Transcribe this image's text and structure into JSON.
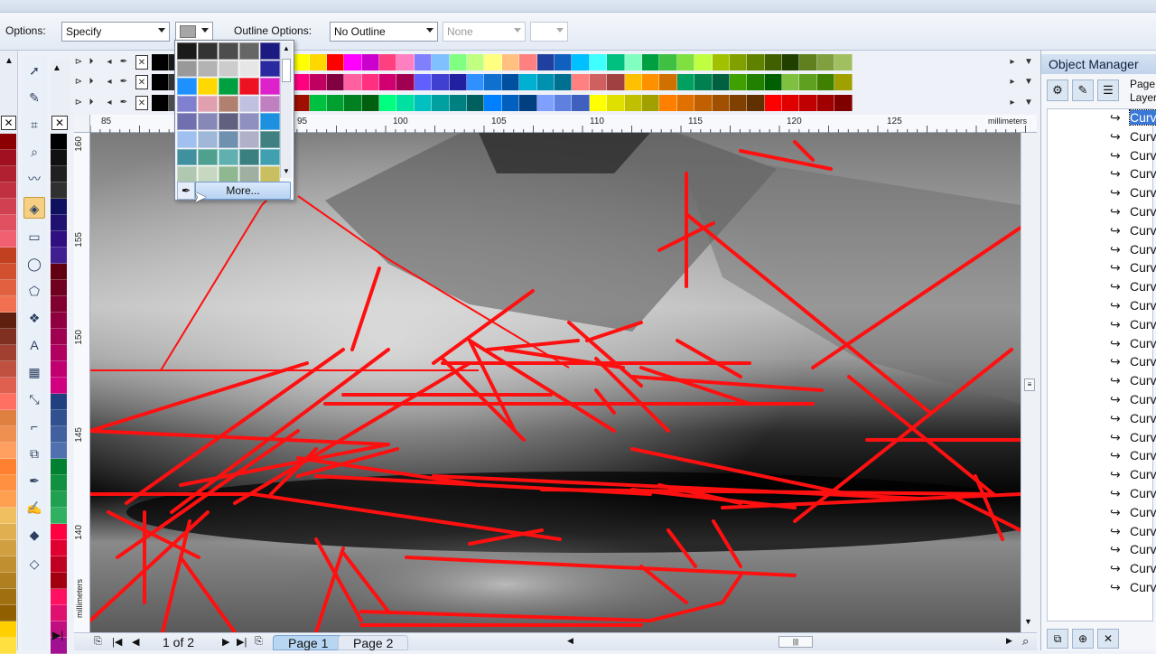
{
  "propbar": {
    "options_label": "Options:",
    "fill_select": "Specify",
    "outline_label": "Outline Options:",
    "outline_select": "No Outline",
    "width_select": "None"
  },
  "ruler": {
    "h_ticks": [
      "85",
      "95",
      "100",
      "105",
      "110",
      "115",
      "120",
      "125"
    ],
    "h_unit": "millimeters",
    "v_ticks": [
      "160",
      "155",
      "150",
      "145",
      "140"
    ],
    "v_unit": "millimeters"
  },
  "popup": {
    "more_label": "More...",
    "colors": [
      "#1a1a1a",
      "#333333",
      "#4d4d4d",
      "#666666",
      "#1a1a80",
      "#999999",
      "#b3b3b3",
      "#cccccc",
      "#e6e6e6",
      "#2a2aa0",
      "#1e90ff",
      "#ffd800",
      "#00a040",
      "#ee1122",
      "#dd22cc",
      "#8080d0",
      "#e0a0b0",
      "#b08070",
      "#c0c0e0",
      "#c080c0",
      "#7070b0",
      "#8888b8",
      "#606080",
      "#9090c0",
      "#1e90e0",
      "#a0c0f0",
      "#a0b8d8",
      "#7090b0",
      "#b0b0c8",
      "#408080",
      "#4090a0",
      "#50a090",
      "#60b0b0",
      "#3a8080",
      "#40a0b0",
      "#b0c8b0",
      "#c8d8c0",
      "#90b890",
      "#a0b0a0",
      "#c8c060"
    ]
  },
  "palettes": {
    "row1": [
      "#000000",
      "#1a1a1a",
      "#7f7f7f",
      "#cccccc",
      "#ffffff",
      "#0000ff",
      "#00a0ff",
      "#00ff00",
      "#ffff00",
      "#ffd800",
      "#ff0000",
      "#ff00ff",
      "#cc00cc",
      "#ff4080",
      "#ff80c0",
      "#8080ff",
      "#80c0ff",
      "#80ff80",
      "#c0ff80",
      "#ffff80",
      "#ffc080",
      "#ff8080",
      "#2040a0",
      "#1060c0",
      "#00c0ff",
      "#40ffff",
      "#00c080",
      "#80ffc0",
      "#00a040",
      "#40c040",
      "#80e040",
      "#c0ff40",
      "#a0c000",
      "#80a000",
      "#608000",
      "#406000",
      "#204000",
      "#608020",
      "#80a040",
      "#a0c060"
    ],
    "row2": [
      "#000000",
      "#333333",
      "#ffd000",
      "#ff8000",
      "#a05000",
      "#ff4000",
      "#d00000",
      "#a00000",
      "#ff0080",
      "#c00060",
      "#800040",
      "#ff60a0",
      "#ff3080",
      "#d00070",
      "#a00050",
      "#6060ff",
      "#4040d0",
      "#2020a0",
      "#3090ff",
      "#1070d0",
      "#0050a0",
      "#00b0d0",
      "#0090b0",
      "#007090",
      "#ff8080",
      "#d06060",
      "#a04040",
      "#ffc000",
      "#ff9000",
      "#d07000",
      "#00a060",
      "#008050",
      "#006040",
      "#40a000",
      "#208000",
      "#006000",
      "#80c040",
      "#60a020",
      "#408000",
      "#a0a000"
    ],
    "row3": [
      "#000000",
      "#4d4d4d",
      "#ff8000",
      "#ffa040",
      "#ffc080",
      "#ff6000",
      "#ff3000",
      "#d02000",
      "#a01000",
      "#00c040",
      "#00a030",
      "#008020",
      "#006010",
      "#00ff80",
      "#00e0a0",
      "#00c0c0",
      "#00a0a0",
      "#008080",
      "#006060",
      "#0080ff",
      "#0060c0",
      "#004080",
      "#80a0ff",
      "#6080e0",
      "#4060c0",
      "#ffff00",
      "#e0e000",
      "#c0c000",
      "#a0a000",
      "#ff8000",
      "#e07000",
      "#c06000",
      "#a05000",
      "#804000",
      "#603000",
      "#ff0000",
      "#e00000",
      "#c00000",
      "#a00000",
      "#800000"
    ],
    "left_col": [
      "#8b0000",
      "#a01020",
      "#b02030",
      "#c03040",
      "#d04050",
      "#e05060",
      "#f06070",
      "#c04020",
      "#d05030",
      "#e06040",
      "#f07050",
      "#602010",
      "#803020",
      "#a04030",
      "#c05040",
      "#e06050",
      "#ff7060",
      "#e08040",
      "#f09050",
      "#ffa060",
      "#ff8030",
      "#ff9040",
      "#ffa050",
      "#f0c060",
      "#e0b050",
      "#d0a040",
      "#c09030",
      "#b08020",
      "#a07010",
      "#906000",
      "#ffd000",
      "#ffe040"
    ],
    "col2": [
      "#000000",
      "#101010",
      "#202020",
      "#303030",
      "#101060",
      "#201070",
      "#301080",
      "#402090",
      "#600010",
      "#700020",
      "#800030",
      "#900040",
      "#a00050",
      "#b00060",
      "#c00070",
      "#d00080",
      "#204080",
      "#305090",
      "#4060a0",
      "#5070b0",
      "#008030",
      "#109040",
      "#20a050",
      "#30b060",
      "#ff0040",
      "#e00030",
      "#c00020",
      "#a00010",
      "#ff1060",
      "#e01070",
      "#c01080",
      "#a01090"
    ]
  },
  "status": {
    "page_count": "1 of 2",
    "page1": "Page 1",
    "page2": "Page 2"
  },
  "object_manager": {
    "title": "Object Manager",
    "page_label": "Page",
    "layer_label": "Layer",
    "items": [
      "Curv",
      "Curv",
      "Curv",
      "Curv",
      "Curv",
      "Curv",
      "Curv",
      "Curv",
      "Curv",
      "Curv",
      "Curv",
      "Curv",
      "Curv",
      "Curv",
      "Curv",
      "Curv",
      "Curv",
      "Curv",
      "Curv",
      "Curv",
      "Curv",
      "Curv",
      "Curv",
      "Curv",
      "Curv",
      "Curv"
    ],
    "selected_index": 0
  }
}
